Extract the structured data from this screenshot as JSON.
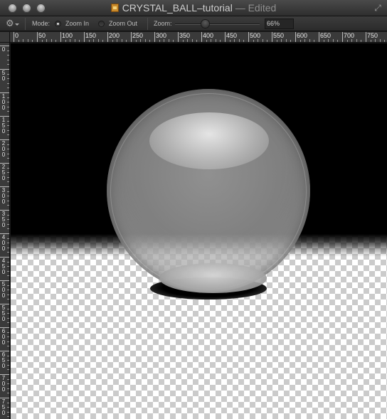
{
  "window": {
    "title": "CRYSTAL_BALL–tutorial",
    "separator": " — ",
    "status": "Edited"
  },
  "toolbar": {
    "mode_label": "Mode:",
    "zoom_in_label": "Zoom In",
    "zoom_out_label": "Zoom Out",
    "selected_mode": "Zoom In",
    "zoom_label": "Zoom:",
    "zoom_value": "66%",
    "zoom_slider_fraction": 0.35
  },
  "rulers": {
    "horizontal_labels": [
      "0",
      "50",
      "100",
      "150",
      "200",
      "250",
      "300",
      "350",
      "400",
      "450",
      "500",
      "550",
      "600",
      "650",
      "700",
      "750"
    ],
    "vertical_labels": [
      "0",
      "50",
      "100",
      "150",
      "200",
      "250",
      "300",
      "350",
      "400",
      "450",
      "500",
      "550",
      "600",
      "650",
      "700",
      "750"
    ]
  },
  "icons": {
    "close": "traffic-light-close-icon",
    "minimize": "traffic-light-minimize-icon",
    "zoom": "traffic-light-zoom-icon",
    "document": "document-icon",
    "fullscreen": "fullscreen-icon",
    "actions": "gear-icon"
  },
  "colors": {
    "canvas_backdrop": "#000000",
    "transparency_checker": "#cbcbcb"
  }
}
